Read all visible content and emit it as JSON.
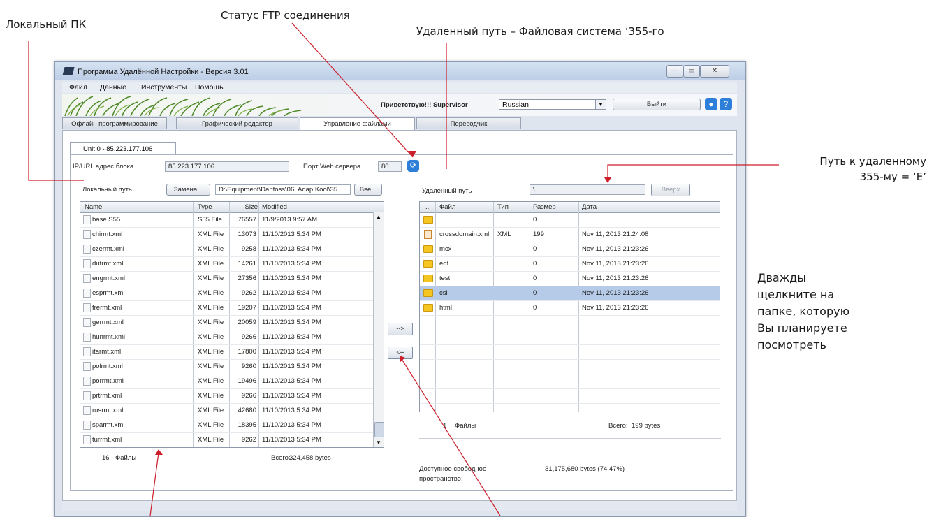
{
  "callouts": {
    "local_pc": "Локальный ПК",
    "ftp_status": "Статус FTP соединения",
    "remote_path": "Удаленный путь –  Файловая система ‘355-го",
    "path_to_remote_1": "Путь к удаленному",
    "path_to_remote_2": "355-му = ‘E’",
    "double_click_1": "Дважды",
    "double_click_2": "щелкните на",
    "double_click_3": "папке, которую",
    "double_click_4": "Вы планируете",
    "double_click_5": "посмотреть"
  },
  "window": {
    "title": "Программа Удалённой Настройки - Версия 3.01",
    "minimize": "—",
    "maximize": "▭",
    "close": "✕"
  },
  "menu": [
    "Файл",
    "Данные",
    "Инструменты",
    "Помощь"
  ],
  "toolbar": {
    "greeting": "Приветствую!!! Supervisor",
    "language": "Russian",
    "logout": "Выйти",
    "user_icon": "person-icon",
    "help_icon": "help-icon"
  },
  "tabs": [
    "Офлайн программирование",
    "Графический редактор",
    "Управление файлами",
    "Переводчик"
  ],
  "active_tab": "Управление файлами",
  "unit_tab": "Unit 0 - 85.223.177.106",
  "connection": {
    "ip_label": "IP/URL адрес блока",
    "ip_value": "85.223.177.106",
    "port_label": "Порт Web сервера",
    "port_value": "80",
    "status_icon": "refresh-icon"
  },
  "local": {
    "path_label": "Локальный путь",
    "replace_button": "Замена...",
    "path_value": "D:\\Equipment\\Danfoss\\06. Adap Kool\\35",
    "up_button": "Вве...",
    "columns": [
      "Name",
      "Type",
      "Size",
      "Modified"
    ],
    "rows": [
      {
        "name": "base.S55",
        "type": "S55 File",
        "size": "76557",
        "modified": "11/9/2013 9:57 AM"
      },
      {
        "name": "chirmt.xml",
        "type": "XML File",
        "size": "13073",
        "modified": "11/10/2013 5:34 PM"
      },
      {
        "name": "czermt.xml",
        "type": "XML File",
        "size": "9258",
        "modified": "11/10/2013 5:34 PM"
      },
      {
        "name": "dutrmt.xml",
        "type": "XML File",
        "size": "14261",
        "modified": "11/10/2013 5:34 PM"
      },
      {
        "name": "engrmt.xml",
        "type": "XML File",
        "size": "27356",
        "modified": "11/10/2013 5:34 PM"
      },
      {
        "name": "esprmt.xml",
        "type": "XML File",
        "size": "9262",
        "modified": "11/10/2013 5:34 PM"
      },
      {
        "name": "frermt.xml",
        "type": "XML File",
        "size": "19207",
        "modified": "11/10/2013 5:34 PM"
      },
      {
        "name": "gerrmt.xml",
        "type": "XML File",
        "size": "20059",
        "modified": "11/10/2013 5:34 PM"
      },
      {
        "name": "hunrmt.xml",
        "type": "XML File",
        "size": "9266",
        "modified": "11/10/2013 5:34 PM"
      },
      {
        "name": "itarmt.xml",
        "type": "XML File",
        "size": "17800",
        "modified": "11/10/2013 5:34 PM"
      },
      {
        "name": "polrmt.xml",
        "type": "XML File",
        "size": "9260",
        "modified": "11/10/2013 5:34 PM"
      },
      {
        "name": "porrmt.xml",
        "type": "XML File",
        "size": "19496",
        "modified": "11/10/2013 5:34 PM"
      },
      {
        "name": "prtrmt.xml",
        "type": "XML File",
        "size": "9266",
        "modified": "11/10/2013 5:34 PM"
      },
      {
        "name": "rusrmt.xml",
        "type": "XML File",
        "size": "42680",
        "modified": "11/10/2013 5:34 PM"
      },
      {
        "name": "sparmt.xml",
        "type": "XML File",
        "size": "18395",
        "modified": "11/10/2013 5:34 PM"
      },
      {
        "name": "turrmt.xml",
        "type": "XML File",
        "size": "9262",
        "modified": "11/10/2013 5:34 PM"
      }
    ],
    "count": "16",
    "count_label": "Файлы",
    "total_label": "Всего:",
    "total_value": "324,458 bytes"
  },
  "transfer": {
    "to_remote": "-->",
    "to_local": "<--"
  },
  "remote": {
    "path_label": "Удаленный путь",
    "path_value": "\\",
    "up_button": "Вверх",
    "columns": [
      "..",
      "Файл",
      "Тип",
      "Размер",
      "Дата"
    ],
    "rows": [
      {
        "icon": "folder-icon",
        "name": "..",
        "type": "",
        "size": "0",
        "date": ""
      },
      {
        "icon": "xml-file-icon",
        "name": "crossdomain.xml",
        "type": "XML",
        "size": "199",
        "date": "Nov 11, 2013 21:24:08"
      },
      {
        "icon": "folder-icon",
        "name": "mcx",
        "type": "",
        "size": "0",
        "date": "Nov 11, 2013 21:23:26"
      },
      {
        "icon": "folder-icon",
        "name": "edf",
        "type": "",
        "size": "0",
        "date": "Nov 11, 2013 21:23:26"
      },
      {
        "icon": "folder-icon",
        "name": "test",
        "type": "",
        "size": "0",
        "date": "Nov 11, 2013 21:23:26"
      },
      {
        "icon": "folder-icon",
        "name": "csi",
        "type": "",
        "size": "0",
        "date": "Nov 11, 2013 21:23:26"
      },
      {
        "icon": "folder-icon",
        "name": "html",
        "type": "",
        "size": "0",
        "date": "Nov 11, 2013 21:23:26"
      }
    ],
    "selected_index": 5,
    "count": "1",
    "count_label": "Файлы",
    "total_label": "Всего:",
    "total_value": "199 bytes",
    "free_space_label_1": "Доступное свободное",
    "free_space_label_2": "пространство:",
    "free_space_value": "31,175,680 bytes (74.47%)"
  },
  "colors": {
    "callout_line": "#cc1f2a",
    "selection": "#b5cbe8",
    "accent_blue": "#2d7fd9"
  }
}
